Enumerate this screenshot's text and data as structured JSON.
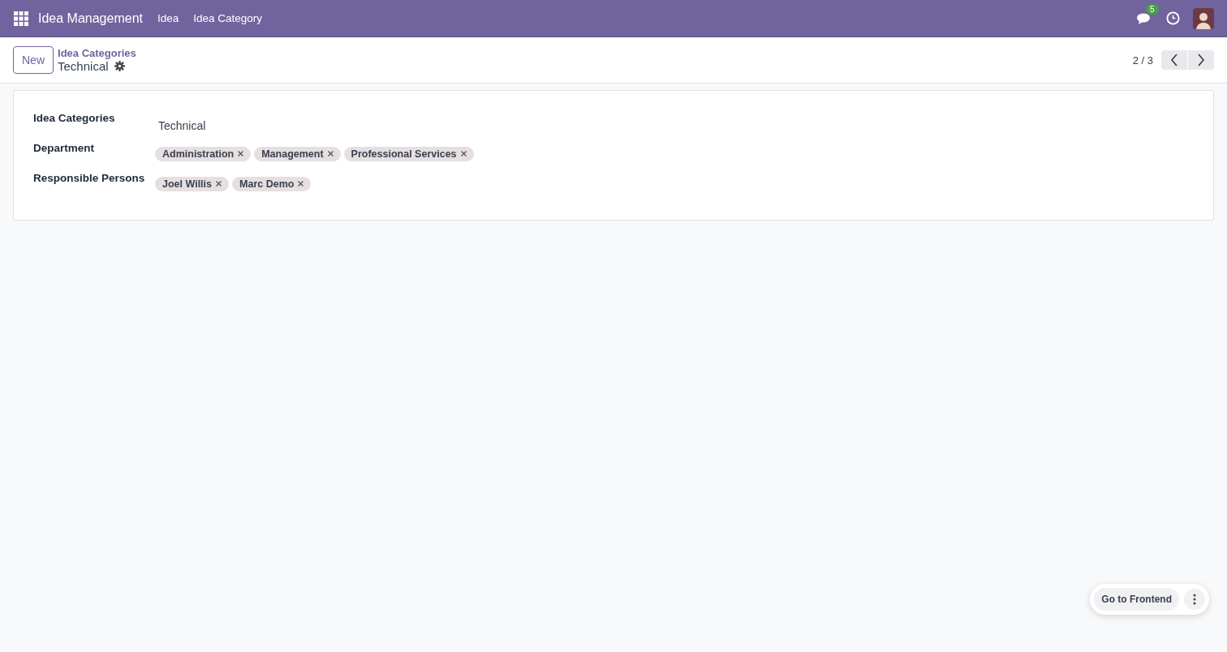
{
  "navbar": {
    "app_name": "Idea Management",
    "menu": [
      "Idea",
      "Idea Category"
    ],
    "message_count": "5"
  },
  "control_panel": {
    "new_button": "New",
    "breadcrumb": "Idea Categories",
    "record_title": "Technical",
    "pager": "2 / 3"
  },
  "form": {
    "fields": [
      {
        "label": "Idea Categories",
        "kind": "text",
        "value": "Technical"
      },
      {
        "label": "Department",
        "kind": "tags",
        "tags": [
          "Administration",
          "Management",
          "Professional Services"
        ]
      },
      {
        "label": "Responsible Persons",
        "kind": "tags",
        "tags": [
          "Joel Willis",
          "Marc Demo"
        ]
      }
    ]
  },
  "frontend_widget": {
    "button": "Go to Frontend"
  }
}
